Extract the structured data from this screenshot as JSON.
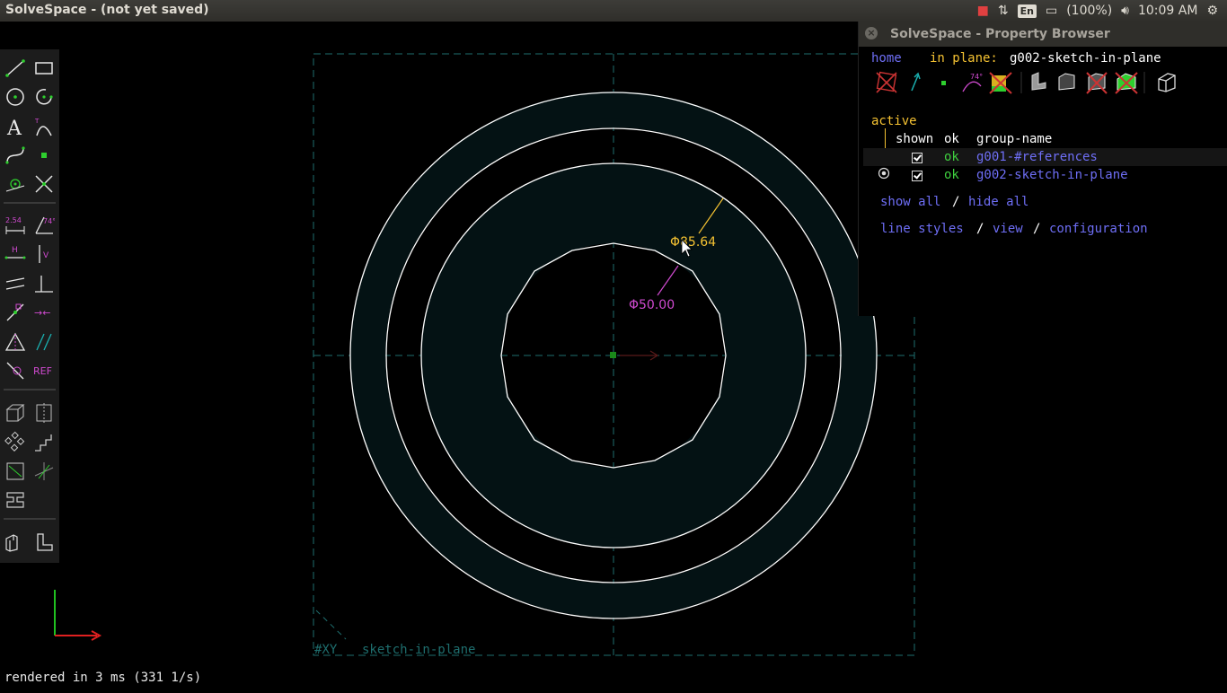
{
  "window": {
    "title": "SolveSpace - (not yet saved)"
  },
  "indicators": {
    "lang": "En",
    "battery": "(100%)",
    "clock": "10:09 AM"
  },
  "status": {
    "text": "rendered in 3 ms (331 1/s)"
  },
  "sketch": {
    "label_workplane": "#XY",
    "label_group": "sketch-in-plane",
    "dim_outer": "Φ85.64",
    "dim_inner": "Φ50.00"
  },
  "toolbar": {
    "ref_label": "REF",
    "dim_label": "2.54",
    "angle_label": "74°",
    "h_label": "H",
    "v_label": "V"
  },
  "browser": {
    "title": "SolveSpace - Property Browser",
    "home": "home",
    "in_plane_label": "in plane:",
    "in_plane_value": "g002-sketch-in-plane",
    "active": "active",
    "col_shown": "shown",
    "col_ok": "ok",
    "col_group": "group-name",
    "groups": [
      {
        "ok": "ok",
        "name": "g001-#references"
      },
      {
        "ok": "ok",
        "name": "g002-sketch-in-plane"
      }
    ],
    "show_all": "show all",
    "slash": "/",
    "hide_all": "hide all",
    "line_styles": "line styles",
    "view": "view",
    "configuration": "configuration"
  },
  "colors": {
    "construction": "#1e6e6e",
    "fill": "#041214",
    "line": "#ffffff",
    "dim_yellow": "#f5c232",
    "dim_magenta": "#d04ad0"
  }
}
